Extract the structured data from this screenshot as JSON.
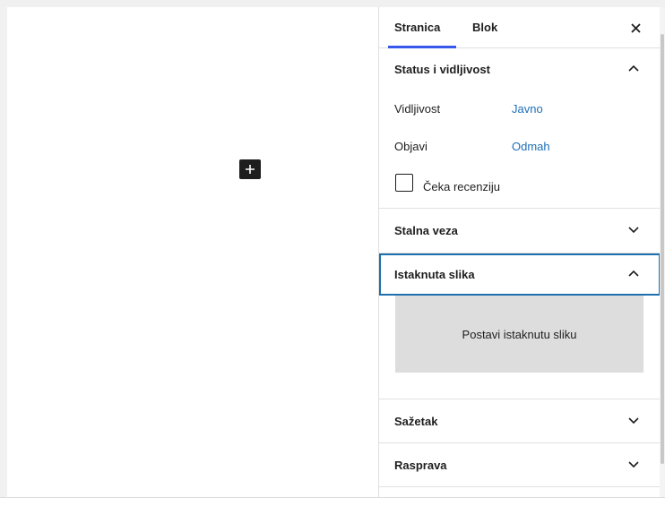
{
  "sidebar": {
    "tabs": [
      {
        "label": "Stranica",
        "active": true
      },
      {
        "label": "Blok",
        "active": false
      }
    ],
    "close_icon": "close-icon",
    "panels": {
      "status": {
        "title": "Status i vidljivost",
        "expanded": true,
        "rows": [
          {
            "label": "Vidljivost",
            "value": "Javno"
          },
          {
            "label": "Objavi",
            "value": "Odmah"
          }
        ],
        "checkbox": {
          "label": "Čeka recenziju",
          "checked": false
        }
      },
      "permalink": {
        "title": "Stalna veza",
        "expanded": false
      },
      "featured_image": {
        "title": "Istaknuta slika",
        "expanded": true,
        "button_label": "Postavi istaknutu sliku"
      },
      "excerpt": {
        "title": "Sažetak",
        "expanded": false
      },
      "discussion": {
        "title": "Rasprava",
        "expanded": false
      }
    }
  },
  "editor": {
    "inserter_icon": "plus-icon"
  },
  "colors": {
    "accent": "#3858e9",
    "link": "#1e6fb8",
    "focus_outline": "#1d6fad",
    "featured_bg": "#dddddd"
  }
}
